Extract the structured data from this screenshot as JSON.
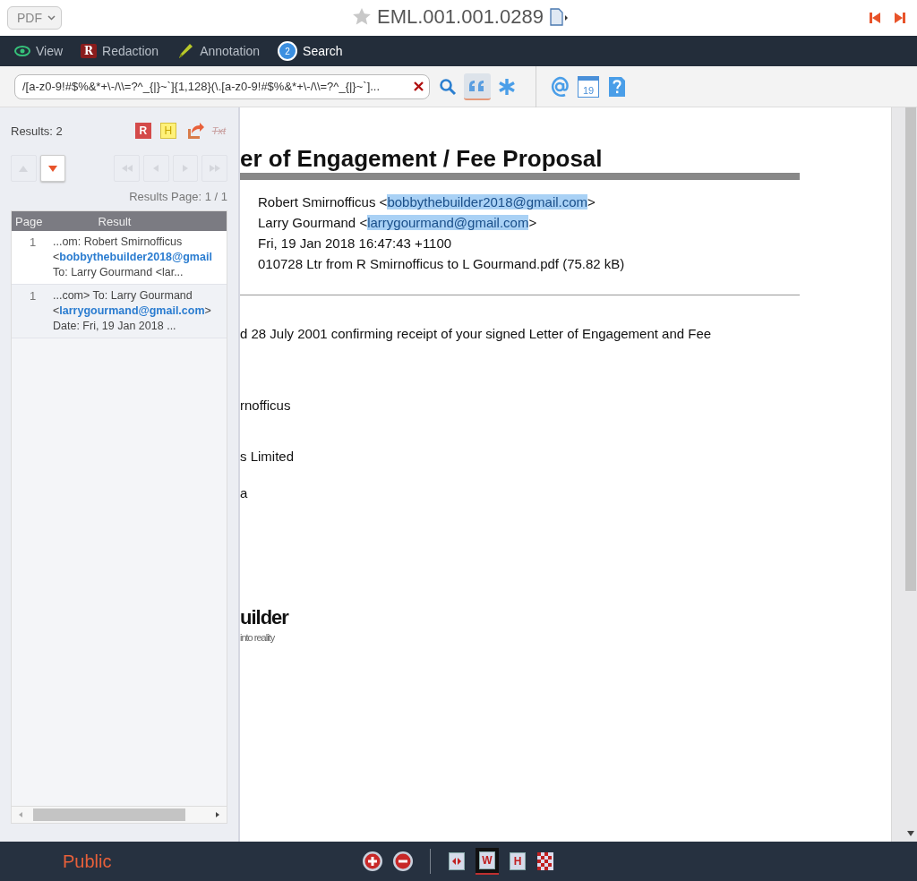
{
  "topbar": {
    "format": "PDF",
    "starred": false,
    "title": "EML.001.001.0289"
  },
  "tabs": [
    {
      "label": "View",
      "kind": "view",
      "selected": false
    },
    {
      "label": "Redaction",
      "kind": "redaction",
      "badge": "R",
      "selected": false
    },
    {
      "label": "Annotation",
      "kind": "annotation",
      "selected": false
    },
    {
      "label": "Search",
      "kind": "search",
      "badge": "2",
      "selected": true
    }
  ],
  "search": {
    "value": "/[a-z0-9!#$%&*+\\-/\\\\=?^_{|}~`]{1,128}(\\.[a-z0-9!#$%&*+\\-/\\\\=?^_{|}~`]...",
    "exact_phrase": true,
    "tool_calendar_day": "19"
  },
  "results_panel": {
    "count": "Results: 2",
    "redact_label": "R",
    "highlight_label": "H",
    "text_label": "Txt",
    "up_disabled": true,
    "down_disabled": false,
    "page_info": "Results Page: 1 / 1",
    "columns": [
      "Page",
      "Result"
    ],
    "rows": [
      {
        "page": "1",
        "lines": [
          "...om: Robert Smirnofficus",
          "<**bobbythebuilder2018@gmail**",
          "To: Larry Gourmand <lar..."
        ]
      },
      {
        "page": "1",
        "lines": [
          "...com> To: Larry Gourmand",
          "<**larrygourmand@gmail.com**>",
          "Date: Fri, 19 Jan 2018 ..."
        ]
      }
    ]
  },
  "document": {
    "title": "er of Engagement / Fee Proposal",
    "header_lines": [
      [
        {
          "text": "Robert Smirnofficus <",
          "highlighted": false
        },
        {
          "text": "bobbythebuilder2018@gmail.com",
          "highlighted": true
        },
        {
          "text": ">",
          "highlighted": false
        }
      ],
      [
        {
          "text": "Larry Gourmand <",
          "highlighted": false
        },
        {
          "text": "larrygourmand@gmail.com",
          "highlighted": true
        },
        {
          "text": ">",
          "highlighted": false
        }
      ],
      [
        {
          "text": "Fri, 19 Jan 2018 16:47:43 +1100",
          "highlighted": false
        }
      ],
      [
        {
          "text": "010728 Ltr from R Smirnofficus to L Gourmand.pdf (75.82 kB)",
          "highlighted": false
        }
      ]
    ],
    "body": [
      "d 28 July 2001 confirming receipt of your signed Letter of Engagement and Fee",
      "rnofficus",
      "s Limited",
      "a"
    ],
    "logo": "uilder",
    "tagline": "into reality"
  },
  "footer": {
    "classification": "Public",
    "view_modes": [
      {
        "kind": "code",
        "selected": false
      },
      {
        "label": "W",
        "selected": true
      },
      {
        "label": "H",
        "selected": false
      }
    ]
  }
}
